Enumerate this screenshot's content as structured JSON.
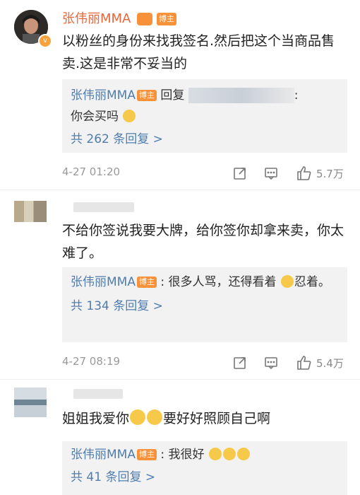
{
  "comments": [
    {
      "author": "张伟丽MMA",
      "badge": "博主",
      "text": "以粉丝的身份来找我签名.然后把这个当商品售卖.这是非常不妥当的",
      "reply": {
        "author": "张伟丽MMA",
        "badge": "博主",
        "prefix": "回复",
        "suffix": ":",
        "text": "你会买吗"
      },
      "more_replies": "共 262 条回复 >",
      "time": "4-27 01:20",
      "likes": "5.7万"
    },
    {
      "author": "",
      "text": "不给你签说我要大牌，给你签你却拿来卖，你太难了。",
      "reply": {
        "author": "张伟丽MMA",
        "badge": "博主",
        "text": ": 很多人骂，还得看着",
        "text_end": "忍着。"
      },
      "more_replies": "共 134 条回复 >",
      "time": "4-27 08:19",
      "likes": "5.4万"
    },
    {
      "author": "",
      "text_before": "姐姐我爱你",
      "text_after": "要好好照顾自己啊",
      "reply": {
        "author": "张伟丽MMA",
        "badge": "博主",
        "text": ": 我很好"
      },
      "more_replies": "共 41 条回复 >"
    }
  ],
  "colors": {
    "username": "#e8683d",
    "reply_name": "#507daf",
    "badge": "#f7913a",
    "reply_bg": "#f2f2f2"
  },
  "icons": [
    "share-icon",
    "comment-icon",
    "like-icon",
    "verified-icon",
    "emoji-icon"
  ]
}
